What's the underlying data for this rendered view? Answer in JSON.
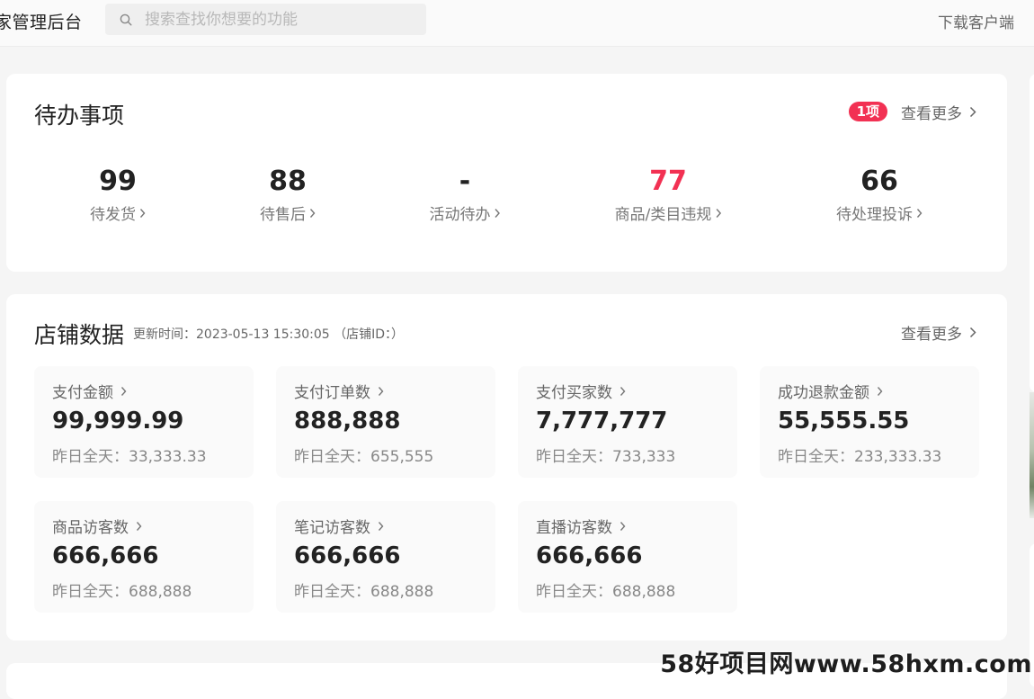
{
  "header": {
    "title": "家管理后台",
    "search_placeholder": "搜索查找你想要的功能",
    "download": "下载客户端"
  },
  "todo": {
    "title": "待办事项",
    "badge": "1项",
    "more": "查看更多",
    "items": [
      {
        "value": "99",
        "label": "待发货"
      },
      {
        "value": "88",
        "label": "待售后"
      },
      {
        "value": "-",
        "label": "活动待办"
      },
      {
        "value": "77",
        "label": "商品/类目违规",
        "highlight": "#f23153"
      },
      {
        "value": "66",
        "label": "待处理投诉"
      }
    ]
  },
  "store": {
    "title": "店铺数据",
    "update_time": "更新时间：2023-05-13 15:30:05 （店铺ID：）",
    "more": "查看更多",
    "metrics": [
      {
        "label": "支付金额",
        "value": "99,999.99",
        "yesterday": "昨日全天：33,333.33"
      },
      {
        "label": "支付订单数",
        "value": "888,888",
        "yesterday": "昨日全天：655,555"
      },
      {
        "label": "支付买家数",
        "value": "7,777,777",
        "yesterday": "昨日全天：733,333"
      },
      {
        "label": "成功退款金额",
        "value": "55,555.55",
        "yesterday": "昨日全天：233,333.33"
      },
      {
        "label": "商品访客数",
        "value": "666,666",
        "yesterday": "昨日全天：688,888"
      },
      {
        "label": "笔记访客数",
        "value": "666,666",
        "yesterday": "昨日全天：688,888"
      },
      {
        "label": "直播访客数",
        "value": "666,666",
        "yesterday": "昨日全天：688,888"
      }
    ]
  },
  "watermark": "58好项目网www.58hxm.com",
  "colors": {
    "accent_red": "#f23153",
    "background": "#f5f5f5"
  },
  "icons": {
    "search": "search-icon",
    "chevron": "chevron-right-icon"
  }
}
